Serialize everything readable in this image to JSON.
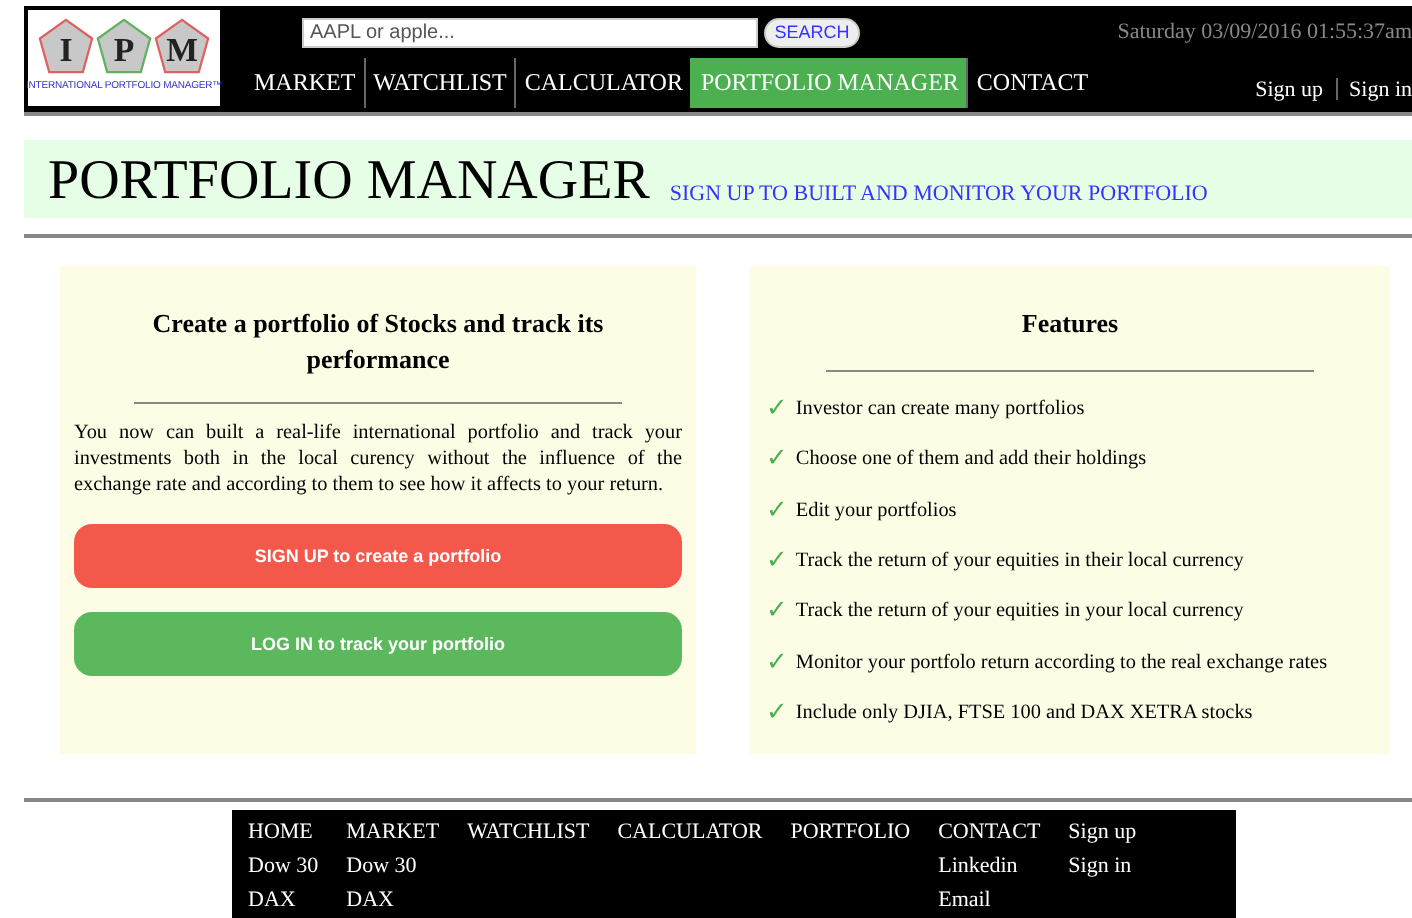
{
  "header": {
    "logo_letters": [
      "I",
      "P",
      "M"
    ],
    "logo_caption": "INTERNATIONAL PORTFOLIO MANAGER™",
    "search": {
      "placeholder": "AAPL or apple...",
      "button": "SEARCH"
    },
    "datetime": "Saturday 03/09/2016 01:55:37am",
    "nav": [
      {
        "label": "MARKET",
        "selected": false
      },
      {
        "label": "WATCHLIST",
        "selected": false
      },
      {
        "label": "CALCULATOR",
        "selected": false
      },
      {
        "label": "PORTFOLIO MANAGER",
        "selected": true
      },
      {
        "label": "CONTACT",
        "selected": false
      }
    ],
    "auth": [
      "Sign up",
      "Sign in"
    ]
  },
  "banner": {
    "title": "PORTFOLIO MANAGER",
    "link": "SIGN UP TO BUILT AND MONITOR YOUR PORTFOLIO"
  },
  "intro": {
    "title": "Create a portfolio of Stocks and track its performance",
    "text": "You now can built a real-life international portfolio and track your investments both in the local curency without the influence of the exchange rate and according to them to see how it affects to your return.",
    "buttons": [
      {
        "kind": "signup",
        "label": "SIGN UP to create a portfolio"
      },
      {
        "kind": "login",
        "label": "LOG IN to track your portfolio"
      }
    ]
  },
  "features": {
    "title": "Features",
    "check": "✓",
    "items": [
      "Investor can create many portfolios",
      "Choose one of them and add their holdings",
      "Edit your portfolios",
      "Track the return of your equities in their local currency",
      "Track the return of your equities in your local currency",
      "Monitor your portfolo return according to the real exchange rates",
      "Include only DJIA, FTSE 100 and DAX XETRA stocks"
    ]
  },
  "footer": {
    "columns": [
      [
        "HOME",
        "Dow 30",
        "DAX"
      ],
      [
        "MARKET",
        "Dow 30",
        "DAX"
      ],
      [
        "WATCHLIST"
      ],
      [
        "CALCULATOR"
      ],
      [
        "PORTFOLIO"
      ],
      [
        "CONTACT",
        "Linkedin",
        "Email"
      ],
      [
        "Sign up",
        "Sign in"
      ]
    ]
  }
}
